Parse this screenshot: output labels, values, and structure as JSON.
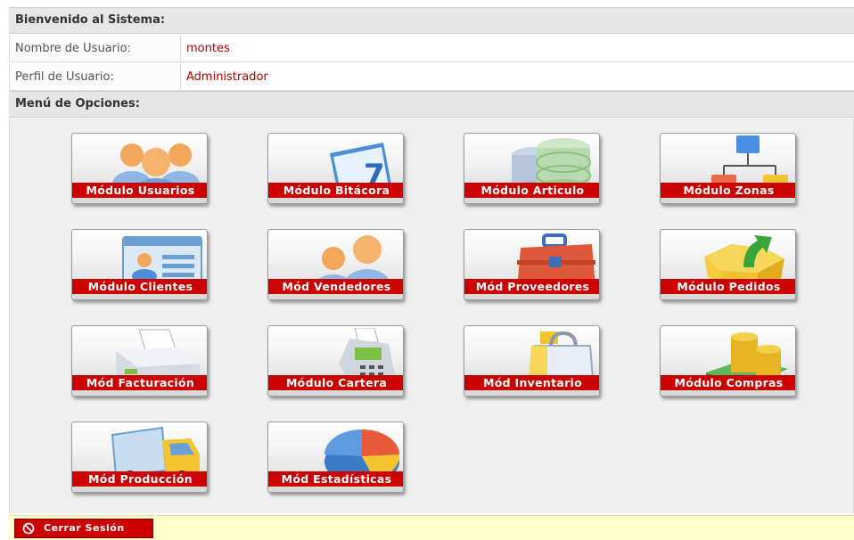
{
  "header": {
    "welcome_title": "Bienvenido al Sistema:"
  },
  "user": {
    "name_label": "Nombre de Usuario:",
    "name_value": "montes",
    "profile_label": "Perfil de Usuario:",
    "profile_value": "Administrador"
  },
  "menu": {
    "title": "Menú de Opciones:",
    "modules": [
      {
        "label": "Módulo Usuarios",
        "icon": "users-icon"
      },
      {
        "label": "Módulo Bitácora",
        "icon": "calendar-icon"
      },
      {
        "label": "Módulo Articulo",
        "icon": "database-icon"
      },
      {
        "label": "Módulo Zonas",
        "icon": "hierarchy-icon"
      },
      {
        "label": "Módulo Clientes",
        "icon": "client-card-icon"
      },
      {
        "label": "Mód Vendedores",
        "icon": "vendors-icon"
      },
      {
        "label": "Mód Proveedores",
        "icon": "toolbox-icon"
      },
      {
        "label": "Módulo Pedidos",
        "icon": "box-arrow-icon"
      },
      {
        "label": "Mód Facturación",
        "icon": "printer-icon"
      },
      {
        "label": "Módulo Cartera",
        "icon": "card-terminal-icon"
      },
      {
        "label": "Mód Inventario",
        "icon": "shopping-bag-icon"
      },
      {
        "label": "Módulo Compras",
        "icon": "coins-icon"
      },
      {
        "label": "Mód Producción",
        "icon": "truck-icon"
      },
      {
        "label": "Mód Estadísticas",
        "icon": "pie-chart-icon"
      }
    ]
  },
  "footer": {
    "logout_label": "Cerrar Sesión",
    "logout_icon": "no-entry-icon"
  },
  "colors": {
    "accent": "#cc0000",
    "value_text": "#b00000",
    "footer_bg": "#ffffcc"
  }
}
